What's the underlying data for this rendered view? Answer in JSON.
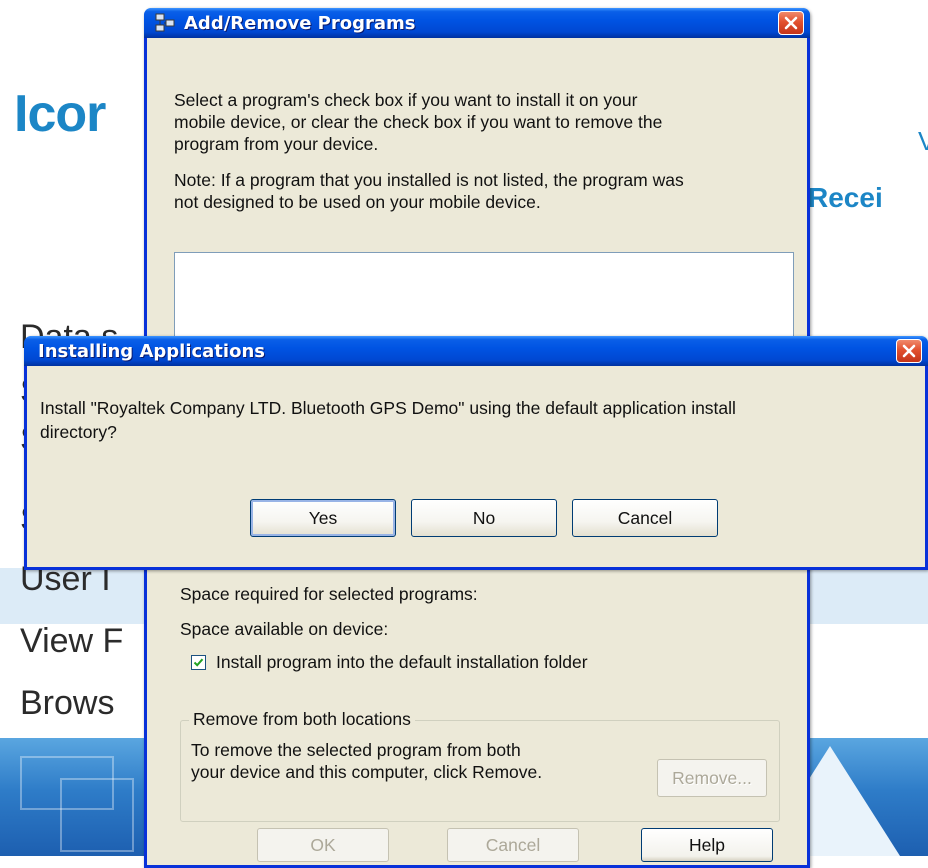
{
  "background": {
    "logo_fragment": "Icor",
    "right_fragment_1": "V",
    "right_fragment_2": "Recei",
    "menu_fragments": [
      "Data s",
      "S",
      "S",
      "S",
      "User I",
      "View F",
      "Brows"
    ]
  },
  "add_remove": {
    "title": "Add/Remove Programs",
    "instruction_lines": [
      "Select a program's check box if you want to install it on your",
      "mobile device, or clear the check box if you want to remove the",
      "program from your device."
    ],
    "note_lines": [
      "Note:  If a program that you installed is not listed, the program was",
      "not designed to be used on your mobile device."
    ],
    "space_required_label": "Space required for selected programs:",
    "space_available_label": "Space available on device:",
    "install_default_checkbox": {
      "label": "Install program into the default installation folder",
      "checked": true
    },
    "remove_group": {
      "legend": "Remove from both locations",
      "text_lines": [
        "To remove the selected program from both",
        "your device and this computer, click Remove."
      ],
      "remove_button": "Remove..."
    },
    "bottom_buttons": {
      "ok": "OK",
      "cancel": "Cancel",
      "help": "Help"
    }
  },
  "installing_dialog": {
    "title": "Installing Applications",
    "message_lines": [
      "Install \"Royaltek Company LTD. Bluetooth GPS Demo\" using the default application install",
      "directory?"
    ],
    "buttons": {
      "yes": "Yes",
      "no": "No",
      "cancel": "Cancel"
    }
  },
  "colors": {
    "title_bar_blue": "#0054e3",
    "dialog_face": "#ece9d8",
    "close_red": "#e2512f",
    "logo_blue": "#1c86c6"
  }
}
